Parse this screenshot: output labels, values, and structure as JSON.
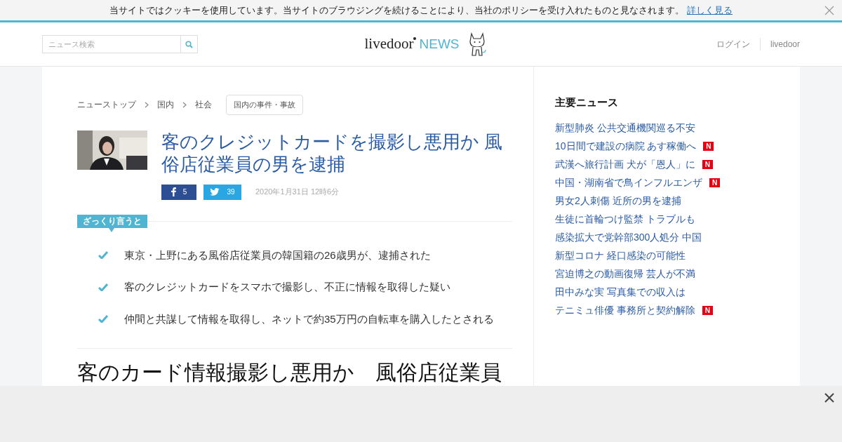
{
  "cookie_bar": {
    "message": "当サイトではクッキーを使用しています。当サイトのブラウジングを続けることにより、当社のポリシーを受け入れたものと見なされます。",
    "link": "詳しく見る"
  },
  "header": {
    "search": {
      "placeholder": "ニュース検索"
    },
    "logo": {
      "word": "livedoor",
      "mark": "NEWS"
    },
    "nav": [
      "ログイン",
      "livedoor"
    ]
  },
  "breadcrumb": [
    "ニューストップ",
    "国内",
    "社会"
  ],
  "category_tag": "国内の事件・事故",
  "article": {
    "title": "客のクレジットカードを撮影し悪用か 風俗店従業員の男を逮捕",
    "facebook_count": "5",
    "twitter_count": "39",
    "date": "2020年1月31日 12時6分",
    "summary_label": "ざっくり言うと",
    "summary": [
      "東京・上野にある風俗店従業員の韓国籍の26歳男が、逮捕された",
      "客のクレジットカードをスマホで撮影し、不正に情報を取得した疑い",
      "仲間と共謀して情報を取得し、ネットで約35万円の自転車を購入したとされる"
    ],
    "headline": "客のカード情報撮影し悪用か　風俗店従業員"
  },
  "sidebar": {
    "title": "主要ニュース",
    "items": [
      {
        "text": "新型肺炎 公共交通機関巡る不安"
      },
      {
        "text": "10日間で建設の病院 あす稼働へ",
        "badge": "N"
      },
      {
        "text": "武漢へ旅行計画 犬が「恩人」に",
        "badge": "N"
      },
      {
        "text": "中国・湖南省で鳥インフルエンザ",
        "badge": "N"
      },
      {
        "text": "男女2人刺傷 近所の男を逮捕"
      },
      {
        "text": "生徒に首輪つけ監禁 トラブルも"
      },
      {
        "text": "感染拡大で党幹部300人処分 中国"
      },
      {
        "text": "新型コロナ 経口感染の可能性"
      },
      {
        "text": "宮迫博之の動画復帰 芸人が不満"
      },
      {
        "text": "田中みな実 写真集での収入は"
      },
      {
        "text": "テニミュ俳優 事務所と契約解除",
        "badge": "N"
      }
    ]
  }
}
